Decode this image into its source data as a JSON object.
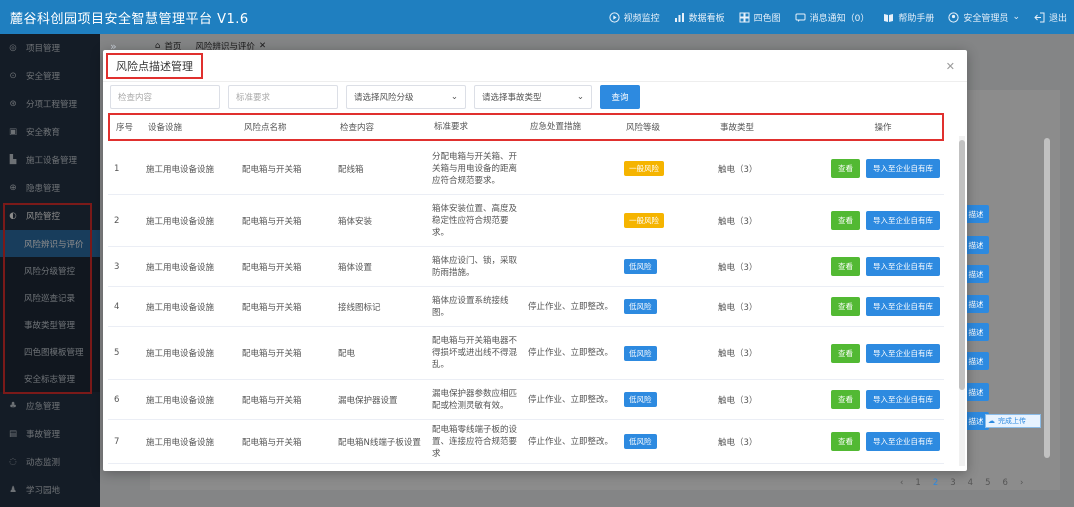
{
  "app": {
    "title": "麓谷科创园项目安全智慧管理平台  V1.6",
    "nav": [
      {
        "icon": "play-circle-icon",
        "label": "视频监控"
      },
      {
        "icon": "bar-chart-icon",
        "label": "数据看板"
      },
      {
        "icon": "grid-icon",
        "label": "四色图"
      },
      {
        "icon": "message-icon",
        "label": "消息通知（0）"
      },
      {
        "icon": "book-icon",
        "label": "帮助手册"
      },
      {
        "icon": "user-icon",
        "label": "安全管理员"
      },
      {
        "icon": "logout-icon",
        "label": "退出"
      }
    ]
  },
  "sidebar": {
    "items": [
      {
        "icon": "project-icon",
        "label": "项目管理"
      },
      {
        "icon": "shield-icon",
        "label": "安全管理"
      },
      {
        "icon": "layers-icon",
        "label": "分项工程管理"
      },
      {
        "icon": "education-icon",
        "label": "安全教育"
      },
      {
        "icon": "equipment-icon",
        "label": "施工设备管理"
      },
      {
        "icon": "hazard-icon",
        "label": "隐患管理"
      },
      {
        "icon": "risk-icon",
        "label": "风险管控"
      }
    ],
    "sub_items": [
      "风险辨识与评价",
      "风险分级管控",
      "风险巡查记录",
      "事故类型管理",
      "四色图模板管理",
      "安全标志管理"
    ],
    "bottom_items": [
      {
        "icon": "emergency-icon",
        "label": "应急管理"
      },
      {
        "icon": "accident-icon",
        "label": "事故管理"
      },
      {
        "icon": "monitor-icon",
        "label": "动态监测"
      },
      {
        "icon": "learning-icon",
        "label": "学习园地"
      }
    ],
    "collapse": "»"
  },
  "tabs": {
    "home": "首页",
    "current": "风险辨识与评价",
    "close": "✕"
  },
  "background": {
    "desc_button": "描述",
    "pager": [
      "‹",
      "1",
      "2",
      "3",
      "4",
      "5",
      "6",
      "›"
    ],
    "upload": "完成上传"
  },
  "modal": {
    "title": "风险点描述管理",
    "close": "✕",
    "filters": {
      "content_placeholder": "检查内容",
      "standard_placeholder": "标准要求",
      "level_select": "请选择风险分级",
      "type_select": "请选择事故类型",
      "query_button": "查询"
    },
    "columns": [
      "序号",
      "设备设施",
      "风险点名称",
      "检查内容",
      "标准要求",
      "应急处置措施",
      "风险等级",
      "事故类型",
      "操作"
    ],
    "actions": {
      "view": "查看",
      "import": "导入至企业自有库"
    },
    "rows": [
      {
        "no": "1",
        "device": "施工用电设备设施",
        "point": "配电箱与开关箱",
        "content": "配线箱",
        "standard": "分配电箱与开关箱、开关箱与用电设备的距离应符合规范要求。",
        "measure": "",
        "level": "一般风险",
        "level_color": "yellow",
        "accident": "触电（3）"
      },
      {
        "no": "2",
        "device": "施工用电设备设施",
        "point": "配电箱与开关箱",
        "content": "箱体安装",
        "standard": "箱体安装位置、高度及稳定性应符合规范要求。",
        "measure": "",
        "level": "一般风险",
        "level_color": "yellow",
        "accident": "触电（3）"
      },
      {
        "no": "3",
        "device": "施工用电设备设施",
        "point": "配电箱与开关箱",
        "content": "箱体设置",
        "standard": "箱体应设门、锁，采取防雨措施。",
        "measure": "",
        "level": "低风险",
        "level_color": "blue",
        "accident": "触电（3）"
      },
      {
        "no": "4",
        "device": "施工用电设备设施",
        "point": "配电箱与开关箱",
        "content": "接线图标记",
        "standard": "箱体应设置系统接线图。",
        "measure": "停止作业、立即整改。",
        "level": "低风险",
        "level_color": "blue",
        "accident": "触电（3）"
      },
      {
        "no": "5",
        "device": "施工用电设备设施",
        "point": "配电箱与开关箱",
        "content": "配电",
        "standard": "配电箱与开关箱电器不得损坏或进出线不得混乱。",
        "measure": "停止作业、立即整改。",
        "level": "低风险",
        "level_color": "blue",
        "accident": "触电（3）"
      },
      {
        "no": "6",
        "device": "施工用电设备设施",
        "point": "配电箱与开关箱",
        "content": "漏电保护器设置",
        "standard": "漏电保护器参数应相匹配或检测灵敏有效。",
        "measure": "停止作业、立即整改。",
        "level": "低风险",
        "level_color": "blue",
        "accident": "触电（3）"
      },
      {
        "no": "7",
        "device": "施工用电设备设施",
        "point": "配电箱与开关箱",
        "content": "配电箱N线端子板设置",
        "standard": "配电箱零线端子板的设置、连接应符合规范要求",
        "measure": "停止作业、立即整改。",
        "level": "低风险",
        "level_color": "blue",
        "accident": "触电（3）"
      }
    ]
  }
}
